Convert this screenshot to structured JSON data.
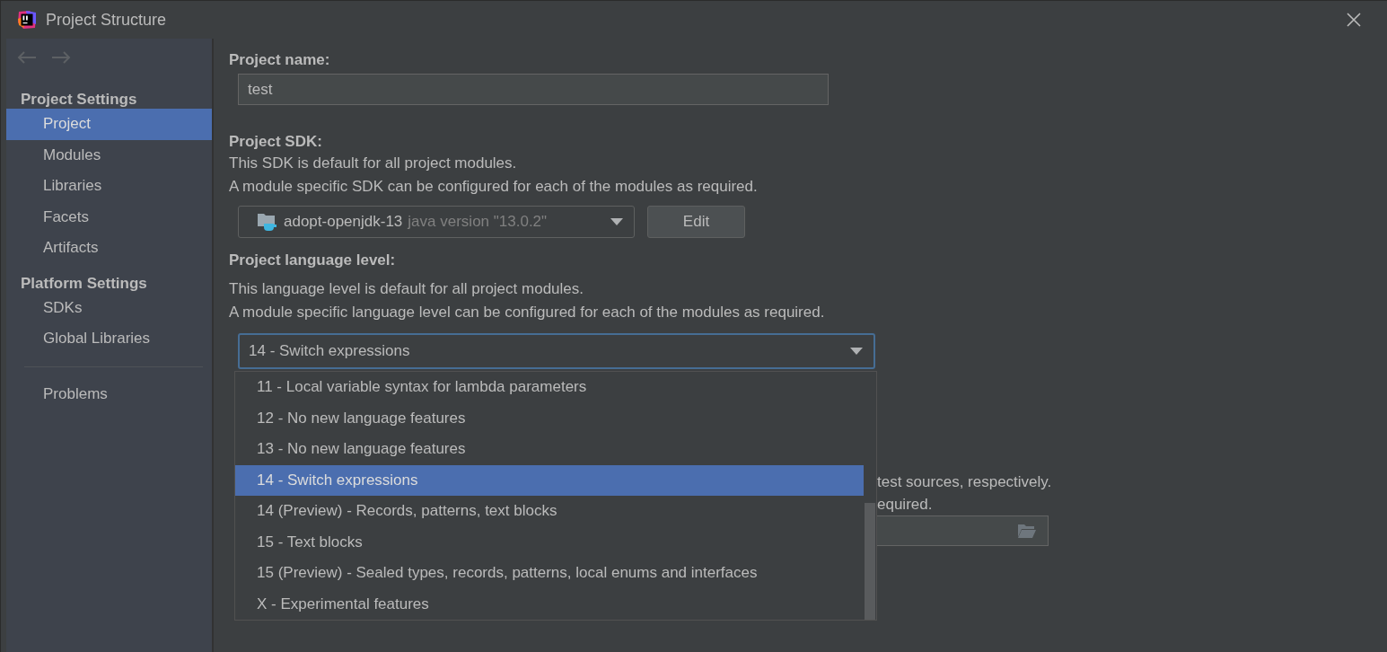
{
  "window": {
    "title": "Project Structure"
  },
  "sidebar": {
    "groups": [
      {
        "title": "Project Settings",
        "items": [
          {
            "label": "Project",
            "selected": true
          },
          {
            "label": "Modules",
            "selected": false
          },
          {
            "label": "Libraries",
            "selected": false
          },
          {
            "label": "Facets",
            "selected": false
          },
          {
            "label": "Artifacts",
            "selected": false
          }
        ]
      },
      {
        "title": "Platform Settings",
        "items": [
          {
            "label": "SDKs",
            "selected": false
          },
          {
            "label": "Global Libraries",
            "selected": false
          }
        ]
      }
    ],
    "extra_items": [
      {
        "label": "Problems",
        "selected": false
      }
    ]
  },
  "project_name": {
    "label": "Project name:",
    "value": "test"
  },
  "project_sdk": {
    "label": "Project SDK:",
    "lines": [
      "This SDK is default for all project modules.",
      "A module specific SDK can be configured for each of the modules as required."
    ],
    "sdk_name": "adopt-openjdk-13",
    "sdk_version": "java version \"13.0.2\"",
    "edit_button": "Edit"
  },
  "language_level": {
    "label": "Project language level:",
    "lines": [
      "This language level is default for all project modules.",
      "A module specific language level can be configured for each of the modules as required."
    ],
    "value": "14 - Switch expressions",
    "options": [
      {
        "label": "11 - Local variable syntax for lambda parameters",
        "selected": false
      },
      {
        "label": "12 - No new language features",
        "selected": false
      },
      {
        "label": "13 - No new language features",
        "selected": false
      },
      {
        "label": "14 - Switch expressions",
        "selected": true
      },
      {
        "label": "14 (Preview) - Records, patterns, text blocks",
        "selected": false
      },
      {
        "label": "15 - Text blocks",
        "selected": false
      },
      {
        "label": "15 (Preview) - Sealed types, records, patterns, local enums and interfaces",
        "selected": false
      },
      {
        "label": "X - Experimental features",
        "selected": false
      }
    ]
  },
  "covered_section": {
    "lines": [
      "test sources, respectively.",
      "equired."
    ]
  }
}
